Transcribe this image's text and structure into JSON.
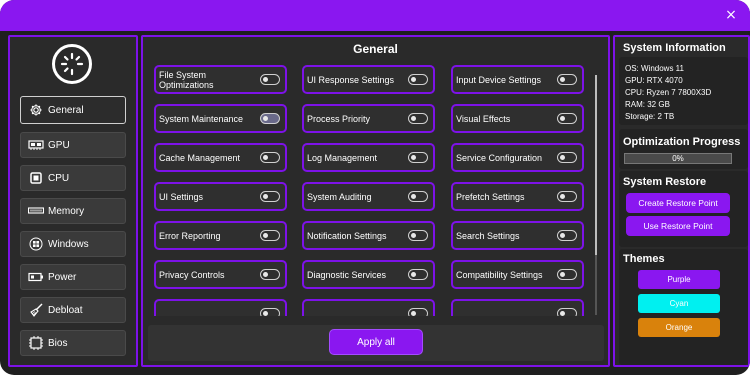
{
  "window": {
    "close_icon": "×"
  },
  "sidebar": {
    "items": [
      {
        "label": "General",
        "icon": "gear-icon",
        "active": true
      },
      {
        "label": "GPU",
        "icon": "gpu-icon"
      },
      {
        "label": "CPU",
        "icon": "cpu-icon"
      },
      {
        "label": "Memory",
        "icon": "memory-icon"
      },
      {
        "label": "Windows",
        "icon": "windows-icon"
      },
      {
        "label": "Power",
        "icon": "battery-icon"
      },
      {
        "label": "Debloat",
        "icon": "broom-icon"
      },
      {
        "label": "Bios",
        "icon": "chip-icon"
      }
    ]
  },
  "main": {
    "title": "General",
    "settings": [
      {
        "label": "File System Optimizations",
        "on": false
      },
      {
        "label": "UI Response Settings",
        "on": false
      },
      {
        "label": "Input Device Settings",
        "on": false
      },
      {
        "label": "System Maintenance",
        "on": true
      },
      {
        "label": "Process Priority",
        "on": false
      },
      {
        "label": "Visual Effects",
        "on": false
      },
      {
        "label": "Cache Management",
        "on": false
      },
      {
        "label": "Log Management",
        "on": false
      },
      {
        "label": "Service Configuration",
        "on": false
      },
      {
        "label": "UI Settings",
        "on": false
      },
      {
        "label": "System Auditing",
        "on": false
      },
      {
        "label": "Prefetch Settings",
        "on": false
      },
      {
        "label": "Error Reporting",
        "on": false
      },
      {
        "label": "Notification Settings",
        "on": false
      },
      {
        "label": "Search Settings",
        "on": false
      },
      {
        "label": "Privacy Controls",
        "on": false
      },
      {
        "label": "Diagnostic Services",
        "on": false
      },
      {
        "label": "Compatibility Settings",
        "on": false
      }
    ],
    "apply_label": "Apply all"
  },
  "right": {
    "system_info": {
      "title": "System Information",
      "lines": [
        "OS: Windows 11",
        "GPU: RTX 4070",
        "CPU: Ryzen 7 7800X3D",
        "RAM: 32 GB",
        "Storage: 2 TB"
      ]
    },
    "progress": {
      "title": "Optimization Progress",
      "value_text": "0%",
      "value": 0
    },
    "restore": {
      "title": "System Restore",
      "create_label": "Create Restore Point",
      "use_label": "Use Restore Point"
    },
    "themes": {
      "title": "Themes",
      "options": [
        {
          "label": "Purple",
          "color": "#8a17f0"
        },
        {
          "label": "Cyan",
          "color": "#00f0f0"
        },
        {
          "label": "Orange",
          "color": "#d9820c"
        }
      ]
    }
  },
  "colors": {
    "accent": "#8a17f0",
    "panel": "#2a2a2a",
    "background": "#1f1f1f"
  }
}
